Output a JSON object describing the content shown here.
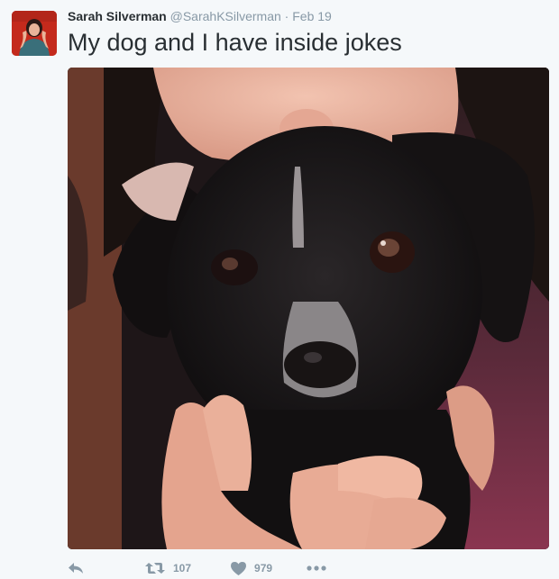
{
  "tweet": {
    "display_name": "Sarah Silverman",
    "screen_name": "@SarahKSilverman",
    "separator": "·",
    "date": "Feb 19",
    "text": "My dog and I have inside jokes"
  },
  "actions": {
    "reply_icon": "reply-icon",
    "retweet_icon": "retweet-icon",
    "retweet_count": "107",
    "like_icon": "heart-icon",
    "like_count": "979",
    "more_icon": "more-icon"
  },
  "colors": {
    "meta_gray": "#8899a6",
    "text": "#292f33",
    "avatar_red": "#c42a1c"
  }
}
